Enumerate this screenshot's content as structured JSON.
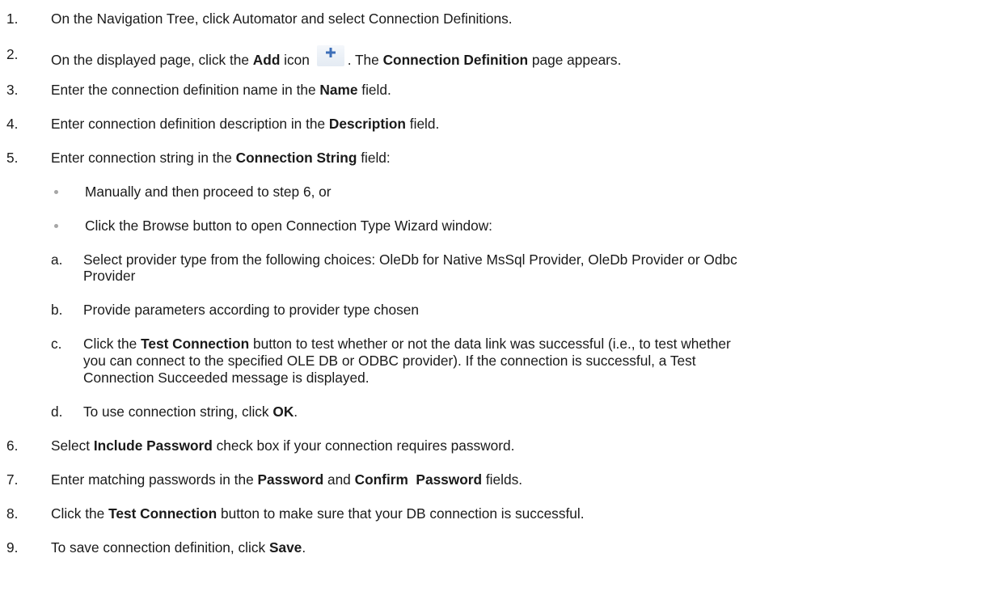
{
  "steps": [
    {
      "num": "1.",
      "text": "On the Navigation Tree, click Automator and select Connection Definitions."
    },
    {
      "num": "2.",
      "t1": "On the displayed page, click the ",
      "b1": "Add",
      "t2": " icon ",
      "t3": ". The ",
      "b2": "Connection Definition",
      "t4": " page appears."
    },
    {
      "num": "3.",
      "t1": "Enter the connection definition name in the ",
      "b1": "Name",
      "t2": " field."
    },
    {
      "num": "4.",
      "t1": "Enter connection definition description in the ",
      "b1": "Description",
      "t2": " field."
    },
    {
      "num": "5.",
      "t1": "Enter connection string in the ",
      "b1": "Connection String",
      "t2": " field:"
    },
    {
      "num": "6.",
      "t1": "Select ",
      "b1": "Include Password",
      "t2": " check box if your connection requires password."
    },
    {
      "num": "7.",
      "t1": "Enter matching passwords in the ",
      "b1": "Password",
      "t2": " and ",
      "b2": "Confirm  Password",
      "t3": " fields."
    },
    {
      "num": "8.",
      "t1": "Click the ",
      "b1": "Test Connection",
      "t2": " button to make sure that your DB connection is successful."
    },
    {
      "num": "9.",
      "t1": "To save connection definition, click ",
      "b1": "Save",
      "t2": "."
    }
  ],
  "bullets": [
    "Manually and then proceed to step 6, or",
    "Click the Browse button to open Connection Type Wizard window:"
  ],
  "substeps": {
    "a": {
      "letter": "a.",
      "line1": "Select provider type from the following choices: OleDb for Native MsSql Provider, OleDb Provider or Odbc",
      "line2": "Provider"
    },
    "b": {
      "letter": "b.",
      "text": "Provide parameters according to provider type chosen"
    },
    "c": {
      "letter": "c.",
      "t1": "Click the ",
      "b1": "Test Connection",
      "t2": " button to test whether or not the data link was successful (i.e., to test whether",
      "line2": "you can connect to the specified OLE DB or ODBC provider). If the connection is successful, a Test",
      "line3": "Connection Succeeded message is displayed."
    },
    "d": {
      "letter": "d.",
      "t1": "To use connection string, click ",
      "b1": "OK",
      "t2": "."
    }
  },
  "icons": {
    "add": "plus-icon",
    "add_color": "#3d6fb8"
  }
}
